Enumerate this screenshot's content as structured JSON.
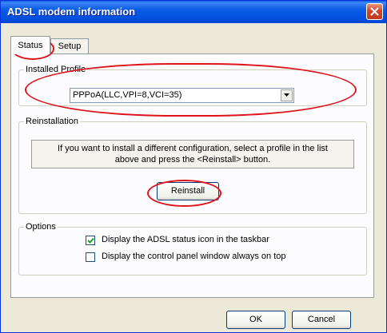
{
  "window": {
    "title": "ADSL modem information"
  },
  "tabs": [
    {
      "label": "Status",
      "active": true
    },
    {
      "label": "Setup",
      "active": false
    }
  ],
  "installed_profile": {
    "legend": "Installed Profile",
    "selected": "PPPoA(LLC,VPI=8,VCI=35)"
  },
  "reinstallation": {
    "legend": "Reinstallation",
    "info_line1": "If you want to install a different configuration, select a profile in the list",
    "info_line2": "above and press the <Reinstall> button.",
    "reinstall_label": "Reinstall"
  },
  "options": {
    "legend": "Options",
    "items": [
      {
        "label": "Display the ADSL status icon in the taskbar",
        "checked": true
      },
      {
        "label": "Display the control panel window always on top",
        "checked": false
      }
    ]
  },
  "footer": {
    "ok_label": "OK",
    "cancel_label": "Cancel"
  },
  "colors": {
    "titlebar": "#0553E2",
    "annotation": "#E0131C",
    "dialog_bg": "#ECE9D8"
  }
}
